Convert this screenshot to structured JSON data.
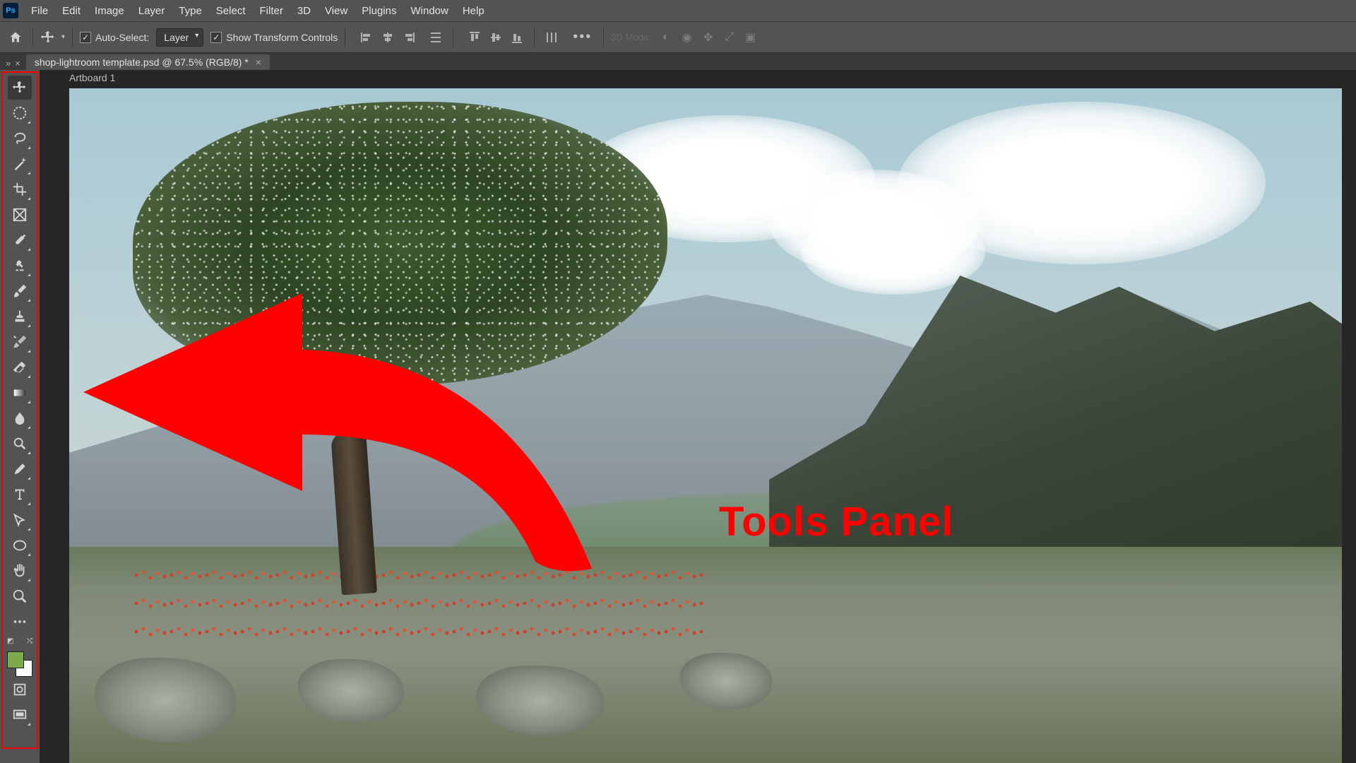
{
  "app": {
    "logo": "Ps"
  },
  "menubar": [
    "File",
    "Edit",
    "Image",
    "Layer",
    "Type",
    "Select",
    "Filter",
    "3D",
    "View",
    "Plugins",
    "Window",
    "Help"
  ],
  "options": {
    "auto_select_label": "Auto-Select:",
    "layer_dropdown": "Layer",
    "transform_label": "Show Transform Controls",
    "mode3d_label": "3D Mode:"
  },
  "doctab": {
    "collapse": "»",
    "close_small": "×",
    "title": "shop-lightroom template.psd @ 67.5% (RGB/8) *",
    "tab_close": "×"
  },
  "artboard_name": "Artboard 1",
  "tools": [
    {
      "id": "move",
      "name": "move-tool",
      "active": true,
      "mk": false
    },
    {
      "id": "marquee",
      "name": "marquee-tool",
      "active": false,
      "mk": true
    },
    {
      "id": "lasso",
      "name": "lasso-tool",
      "active": false,
      "mk": true
    },
    {
      "id": "wand",
      "name": "selection-tool",
      "active": false,
      "mk": true
    },
    {
      "id": "crop",
      "name": "crop-tool",
      "active": false,
      "mk": true
    },
    {
      "id": "frame",
      "name": "frame-tool",
      "active": false,
      "mk": false
    },
    {
      "id": "eyedrop",
      "name": "eyedropper-tool",
      "active": false,
      "mk": true
    },
    {
      "id": "heal",
      "name": "healing-tool",
      "active": false,
      "mk": true
    },
    {
      "id": "brush",
      "name": "brush-tool",
      "active": false,
      "mk": true
    },
    {
      "id": "stamp",
      "name": "stamp-tool",
      "active": false,
      "mk": true
    },
    {
      "id": "history",
      "name": "history-brush-tool",
      "active": false,
      "mk": true
    },
    {
      "id": "eraser",
      "name": "eraser-tool",
      "active": false,
      "mk": true
    },
    {
      "id": "gradient",
      "name": "gradient-tool",
      "active": false,
      "mk": true
    },
    {
      "id": "blur",
      "name": "blur-tool",
      "active": false,
      "mk": true
    },
    {
      "id": "dodge",
      "name": "dodge-tool",
      "active": false,
      "mk": true
    },
    {
      "id": "pen",
      "name": "pen-tool",
      "active": false,
      "mk": true
    },
    {
      "id": "type",
      "name": "type-tool",
      "active": false,
      "mk": true
    },
    {
      "id": "path",
      "name": "path-select-tool",
      "active": false,
      "mk": true
    },
    {
      "id": "shape",
      "name": "shape-tool",
      "active": false,
      "mk": true
    },
    {
      "id": "hand",
      "name": "hand-tool",
      "active": false,
      "mk": true
    },
    {
      "id": "zoom",
      "name": "zoom-tool",
      "active": false,
      "mk": false
    },
    {
      "id": "more",
      "name": "edit-toolbar",
      "active": false,
      "mk": false
    }
  ],
  "swatches": {
    "foreground": "#7aaa4a",
    "background": "#ffffff"
  },
  "annotation": {
    "text": "Tools Panel"
  }
}
